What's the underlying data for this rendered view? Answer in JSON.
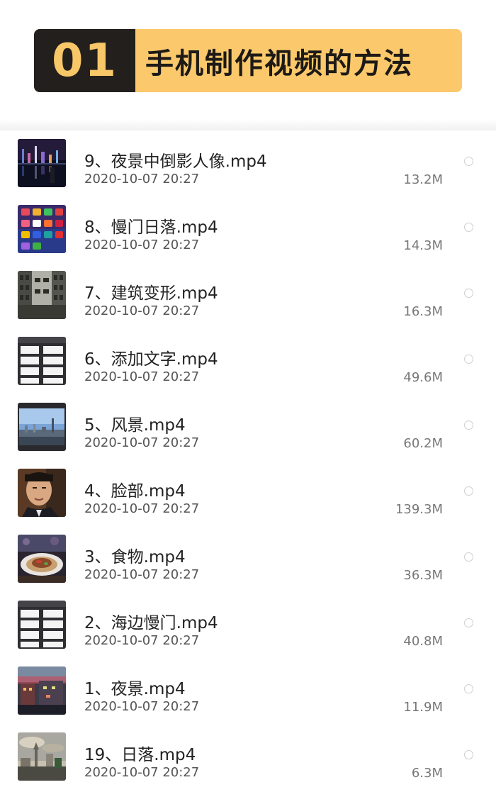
{
  "banner": {
    "number": "01",
    "title": "手机制作视频的方法",
    "colors": {
      "number_bg": "#231f1c",
      "number_text": "#f7c768",
      "title_bg": "#fbc96b"
    }
  },
  "files": [
    {
      "name": "9、夜景中倒影人像.mp4",
      "date": "2020-10-07 20:27",
      "size": "13.2M",
      "thumb": "night-skyline-thumbnail"
    },
    {
      "name": "8、慢门日落.mp4",
      "date": "2020-10-07 20:27",
      "size": "14.3M",
      "thumb": "phone-app-grid-thumbnail"
    },
    {
      "name": "7、建筑变形.mp4",
      "date": "2020-10-07 20:27",
      "size": "16.3M",
      "thumb": "building-facade-thumbnail"
    },
    {
      "name": "6、添加文字.mp4",
      "date": "2020-10-07 20:27",
      "size": "49.6M",
      "thumb": "app-menu-thumbnail"
    },
    {
      "name": "5、风景.mp4",
      "date": "2020-10-07 20:27",
      "size": "60.2M",
      "thumb": "city-landscape-thumbnail"
    },
    {
      "name": "4、脸部.mp4",
      "date": "2020-10-07 20:27",
      "size": "139.3M",
      "thumb": "face-portrait-thumbnail"
    },
    {
      "name": "3、食物.mp4",
      "date": "2020-10-07 20:27",
      "size": "36.3M",
      "thumb": "food-plate-thumbnail"
    },
    {
      "name": "2、海边慢门.mp4",
      "date": "2020-10-07 20:27",
      "size": "40.8M",
      "thumb": "app-menu-thumbnail"
    },
    {
      "name": "1、夜景.mp4",
      "date": "2020-10-07 20:27",
      "size": "11.9M",
      "thumb": "night-street-thumbnail"
    },
    {
      "name": "19、日落.mp4",
      "date": "2020-10-07 20:27",
      "size": "6.3M",
      "thumb": "sunset-sky-thumbnail"
    }
  ]
}
